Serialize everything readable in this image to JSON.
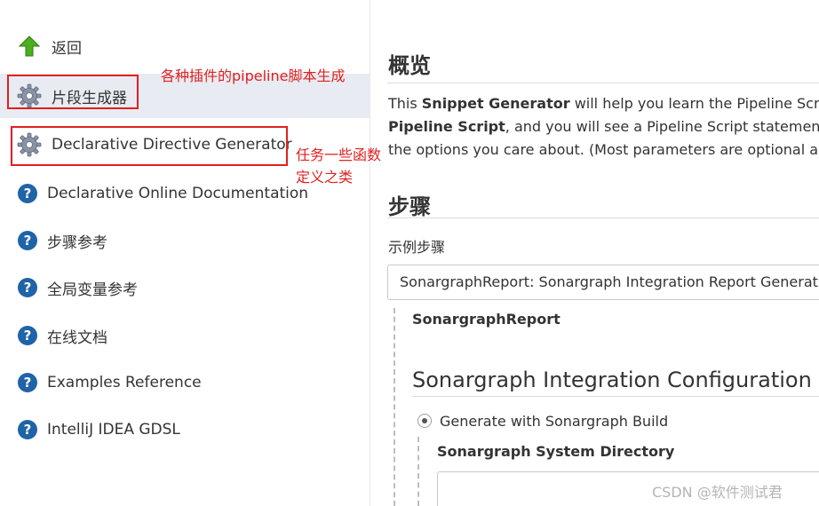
{
  "sidebar": {
    "items": [
      {
        "label": "返回",
        "icon": "up-arrow-icon"
      },
      {
        "label": "片段生成器",
        "icon": "gear-icon"
      },
      {
        "label": "Declarative Directive Generator",
        "icon": "gear-icon"
      },
      {
        "label": "Declarative Online Documentation",
        "icon": "help-icon"
      },
      {
        "label": "步骤参考",
        "icon": "help-icon"
      },
      {
        "label": "全局变量参考",
        "icon": "help-icon"
      },
      {
        "label": "在线文档",
        "icon": "help-icon"
      },
      {
        "label": "Examples Reference",
        "icon": "help-icon"
      },
      {
        "label": "IntelliJ IDEA GDSL",
        "icon": "help-icon"
      }
    ]
  },
  "annotations": {
    "snippet_note": "各种插件的pipeline脚本生成",
    "directive_note_line1": "任务一些函数",
    "directive_note_line2": "定义之类"
  },
  "main": {
    "overview_title": "概览",
    "desc": {
      "l1_a": "This ",
      "l1_b": "Snippet Generator",
      "l1_c": " will help you learn the Pipeline Script c",
      "l2_a": "Pipeline Script",
      "l2_b": ", and you will see a Pipeline Script statement tha",
      "l3": "the options you care about. (Most parameters are optional and"
    },
    "steps_title": "步骤",
    "sample_step_label": "示例步骤",
    "sample_step_value": "SonargraphReport: Sonargraph Integration Report Generation",
    "step_name": "SonargraphReport",
    "config_title": "Sonargraph Integration Configuration",
    "radio_label": "Generate with Sonargraph Build",
    "system_dir_label": "Sonargraph System Directory",
    "system_dir_value": ""
  },
  "watermark": "CSDN @软件测试君",
  "colors": {
    "annotation_red": "#e02020",
    "active_bg": "#e8ecf2",
    "help_icon_blue": "#1f63a8",
    "arrow_green": "#4caf1e"
  }
}
